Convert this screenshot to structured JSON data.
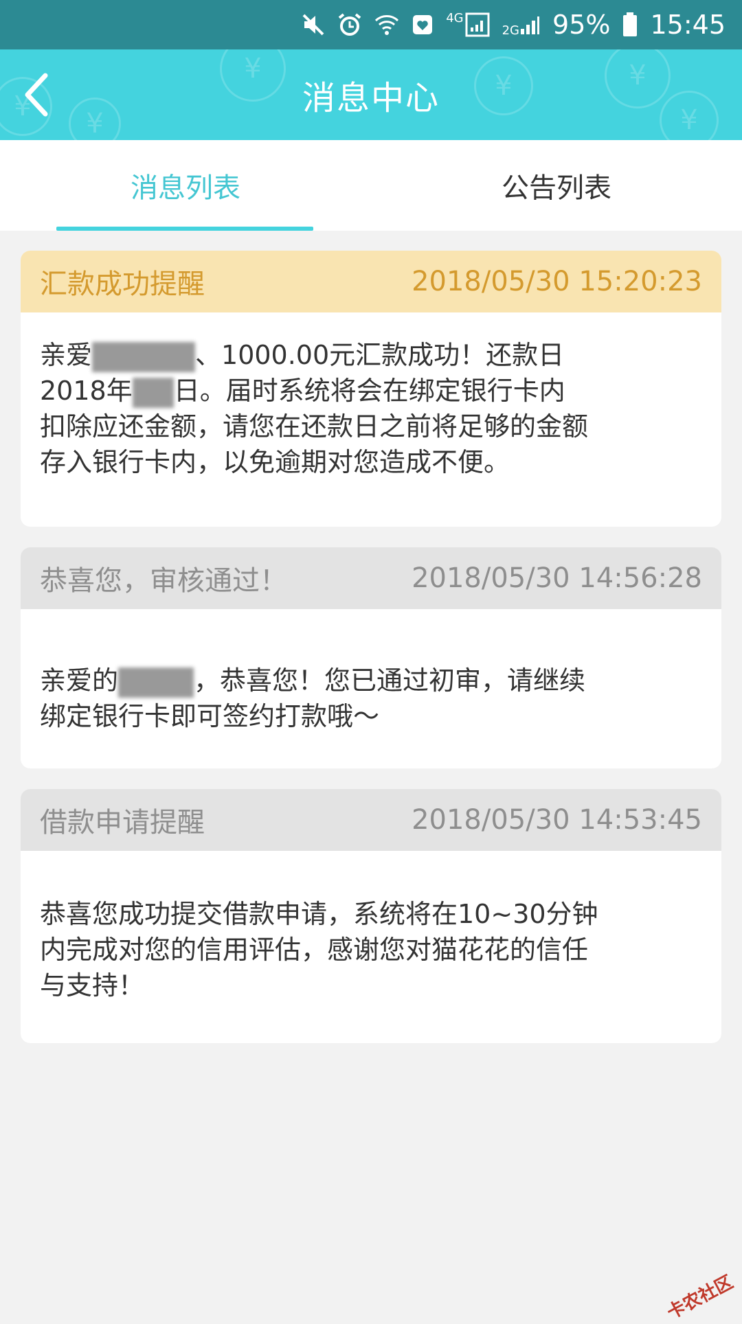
{
  "statusbar": {
    "network_4g": "4G",
    "network_2g": "2G",
    "battery": "95%",
    "time": "15:45"
  },
  "header": {
    "title": "消息中心"
  },
  "tabs": [
    {
      "label": "消息列表",
      "active": true
    },
    {
      "label": "公告列表",
      "active": false
    }
  ],
  "messages": [
    {
      "title": "汇款成功提醒",
      "time": "2018/05/30 15:20:23",
      "lines": [
        {
          "prefix": "亲爱",
          "suffix": "、1000.00元汇款成功！还款日"
        },
        {
          "prefix": "2018年",
          "suffix": "日。届时系统将会在绑定银行卡内"
        },
        {
          "text": "扣除应还金额，请您在还款日之前将足够的金额"
        },
        {
          "text": "存入银行卡内，以免逾期对您造成不便。"
        }
      ]
    },
    {
      "title": "恭喜您，审核通过！",
      "time": "2018/05/30 14:56:28",
      "lines": [
        {
          "prefix": "亲爱的",
          "suffix": "，恭喜您！您已通过初审，请继续"
        },
        {
          "text": "绑定银行卡即可签约打款哦～"
        }
      ]
    },
    {
      "title": "借款申请提醒",
      "time": "2018/05/30 14:53:45",
      "lines": [
        {
          "text": "恭喜您成功提交借款申请，系统将在10~30分钟"
        },
        {
          "text": "内完成对您的信用评估，感谢您对猫花花的信任"
        },
        {
          "text": "与支持！"
        }
      ]
    }
  ],
  "watermark": "卡农社区"
}
